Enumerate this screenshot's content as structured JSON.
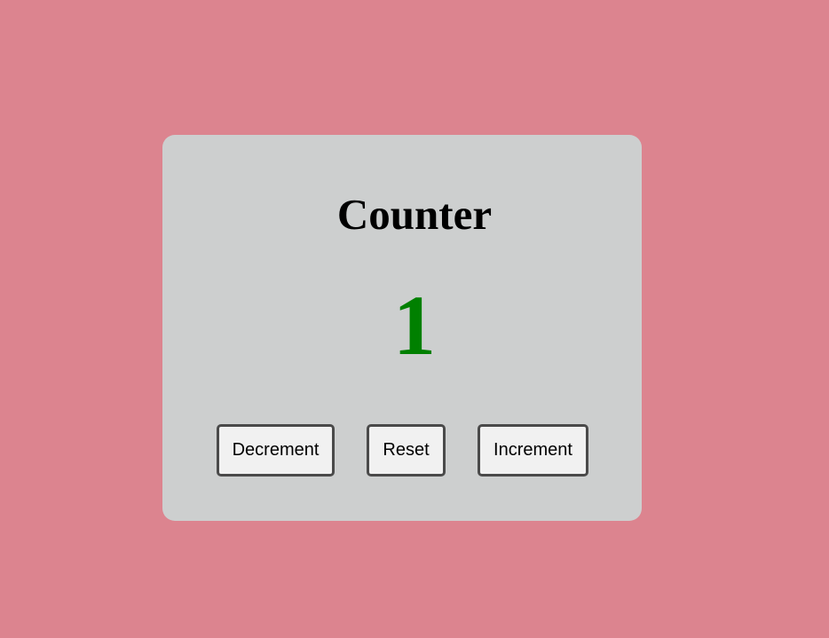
{
  "counter": {
    "title": "Counter",
    "value": "1",
    "value_color": "#008000"
  },
  "buttons": {
    "decrement_label": "Decrement",
    "reset_label": "Reset",
    "increment_label": "Increment"
  },
  "colors": {
    "background": "#dc848f",
    "card": "#cdcfcf",
    "button_bg": "#f1f1f1",
    "button_border": "#4a4a4a"
  }
}
